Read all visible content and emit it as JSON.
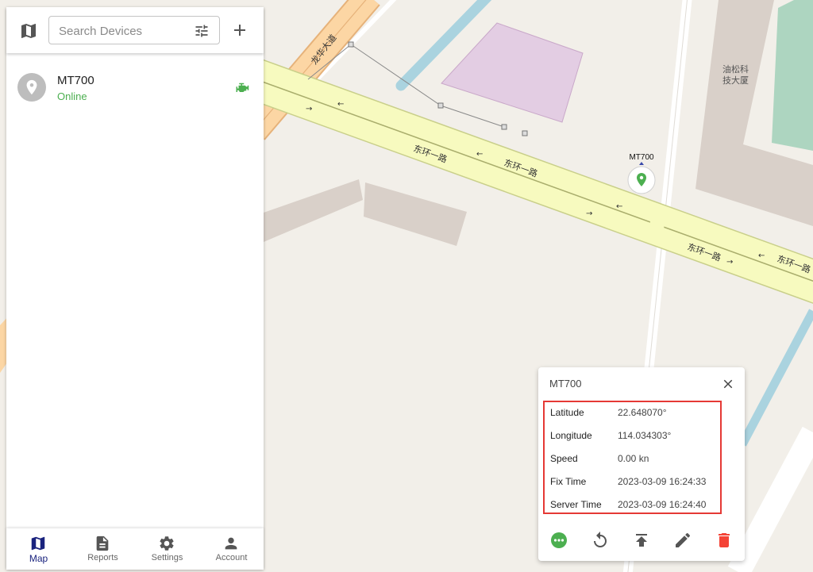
{
  "map": {
    "road_labels": [
      "东环一路",
      "东环一路",
      "东环一路",
      "东环一路",
      "龙华大道"
    ],
    "building_label_line1": "油松科",
    "building_label_line2": "技大厦",
    "marker_label": "MT700",
    "colors": {
      "background": "#f2efe9",
      "major_road": "#f7fabf",
      "arterial": "#fcd6a4",
      "building": "#d9d0c9",
      "poi": "#e3cde3",
      "park": "#add5c0",
      "water": "#aad3df"
    }
  },
  "search": {
    "placeholder": "Search Devices",
    "value": ""
  },
  "toolbar": {
    "map_icon": "map-icon",
    "filter_icon": "tune-icon",
    "add_icon": "plus-icon"
  },
  "devices": [
    {
      "name": "MT700",
      "status": "Online",
      "status_color": "#4caf50",
      "icon": "location-pin-icon",
      "engine_icon": "engine-icon"
    }
  ],
  "nav": [
    {
      "label": "Map",
      "icon": "map-icon",
      "active": true
    },
    {
      "label": "Reports",
      "icon": "description-icon",
      "active": false
    },
    {
      "label": "Settings",
      "icon": "gear-icon",
      "active": false
    },
    {
      "label": "Account",
      "icon": "person-icon",
      "active": false
    }
  ],
  "popup": {
    "title": "MT700",
    "rows": [
      {
        "key": "Latitude",
        "value": "22.648070°"
      },
      {
        "key": "Longitude",
        "value": "114.034303°"
      },
      {
        "key": "Speed",
        "value": "0.00 kn"
      },
      {
        "key": "Fix Time",
        "value": "2023-03-09 16:24:33"
      },
      {
        "key": "Server Time",
        "value": "2023-03-09 16:24:40"
      }
    ],
    "actions": [
      "more-icon",
      "replay-icon",
      "upload-icon",
      "edit-icon",
      "delete-icon"
    ],
    "highlight_color": "#e53935"
  }
}
